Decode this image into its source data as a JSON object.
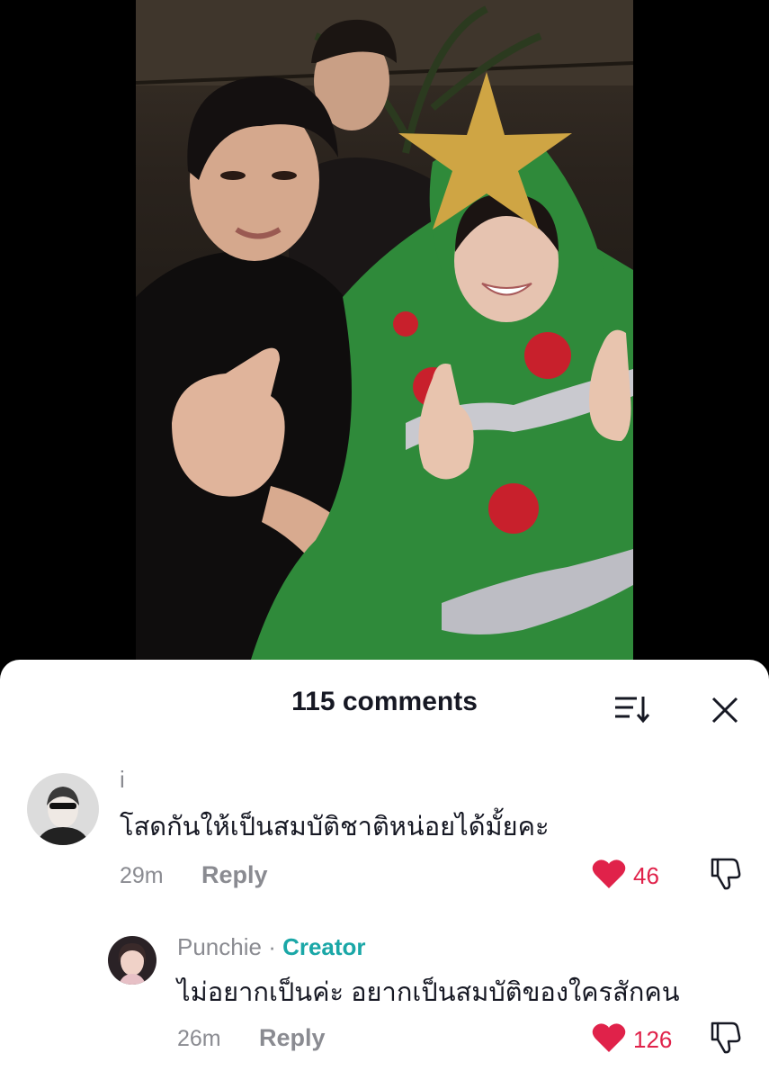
{
  "comments_panel": {
    "title": "115 comments",
    "reply_label": "Reply"
  },
  "comments": [
    {
      "username": "i",
      "text": "โสดกันให้เป็นสมบัติชาติหน่อยได้มั้ยคะ",
      "time": "29m",
      "likes": "46"
    }
  ],
  "reply": {
    "username": "Punchie",
    "separator": " · ",
    "badge": "Creator",
    "text": "ไม่อยากเป็นค่ะ อยากเป็นสมบัติของใครสักคน",
    "time": "26m",
    "likes": "126"
  },
  "colors": {
    "like_red": "#e0224a",
    "creator_teal": "#1aa7a7",
    "tree_green": "#2f8a3a"
  },
  "icons": [
    "sort-icon",
    "close-icon",
    "heart-icon",
    "dislike-icon"
  ]
}
